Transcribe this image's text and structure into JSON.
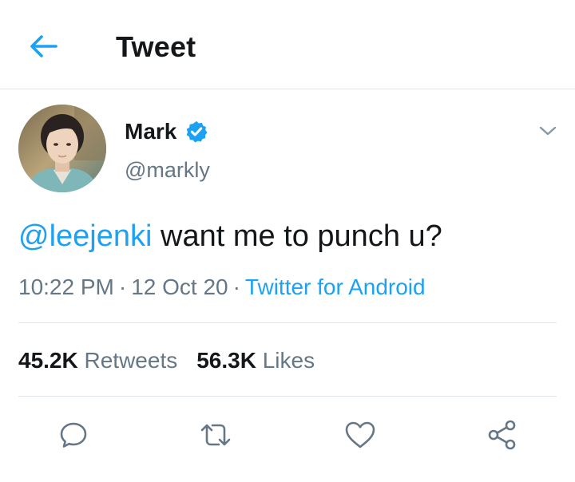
{
  "header": {
    "title": "Tweet",
    "back_icon": "back-arrow-icon"
  },
  "tweet": {
    "author_name": "Mark",
    "verified": true,
    "author_handle": "@markly",
    "mention": "@leejenki",
    "text": " want me to punch u?",
    "time": "10:22 PM",
    "date": "12 Oct 20",
    "separator": "·",
    "source": "Twitter for Android",
    "retweets_count": "45.2K",
    "retweets_label": "Retweets",
    "likes_count": "56.3K",
    "likes_label": "Likes"
  },
  "actions": [
    {
      "name": "reply",
      "icon": "reply-icon"
    },
    {
      "name": "retweet",
      "icon": "retweet-icon"
    },
    {
      "name": "like",
      "icon": "heart-icon"
    },
    {
      "name": "share",
      "icon": "share-icon"
    }
  ],
  "colors": {
    "accent": "#1da1f2",
    "secondary_text": "#657786",
    "primary_text": "#14171a",
    "divider": "#dfe4e8"
  }
}
